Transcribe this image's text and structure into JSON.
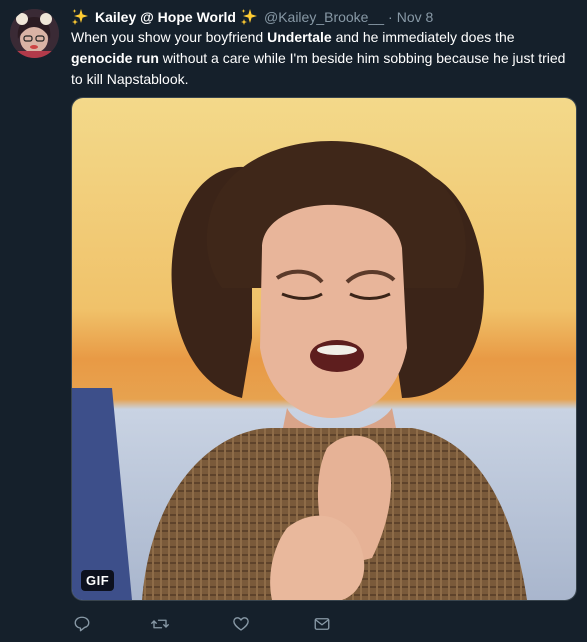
{
  "tweet": {
    "display_name": "Kailey @ Hope World",
    "handle": "@Kailey_Brooke__",
    "separator": "·",
    "date": "Nov 8",
    "text_parts": [
      "When you show your boyfriend ",
      "Undertale",
      " and he immediately does the ",
      "genocide run",
      " without a care while I'm beside him sobbing because he just tried to kill Napstablook."
    ],
    "media": {
      "badge": "GIF"
    }
  },
  "actions": [
    {
      "icon": "reply-icon"
    },
    {
      "icon": "retweet-icon"
    },
    {
      "icon": "like-icon"
    },
    {
      "icon": "message-icon"
    }
  ],
  "colors": {
    "background": "#15202b",
    "secondary_text": "#8899a6",
    "sparkle": "#ffcc33"
  }
}
